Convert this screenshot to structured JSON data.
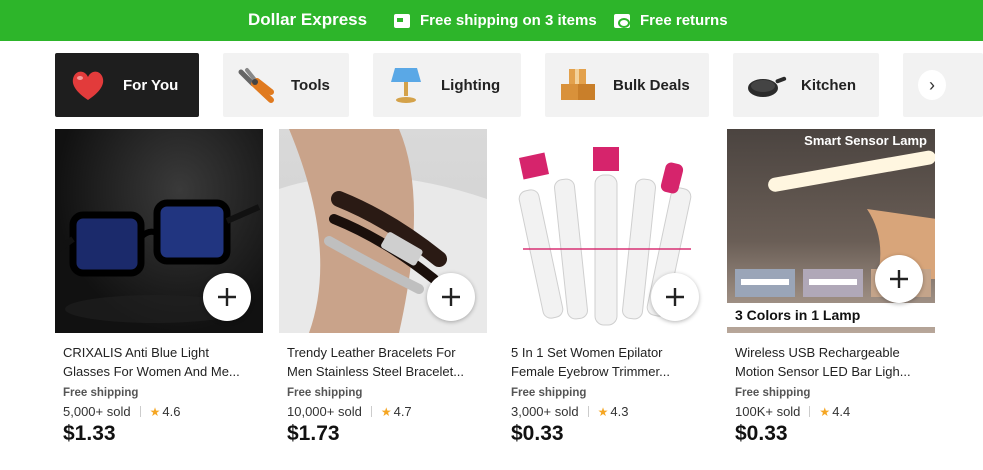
{
  "banner": {
    "brand": "Dollar Express",
    "promo_shipping": "Free shipping on 3 items",
    "promo_returns": "Free returns"
  },
  "categories": [
    {
      "label": "For You",
      "icon": "heart-icon",
      "active": true
    },
    {
      "label": "Tools",
      "icon": "pliers-icon"
    },
    {
      "label": "Lighting",
      "icon": "lamp-icon"
    },
    {
      "label": "Bulk Deals",
      "icon": "boxes-icon"
    },
    {
      "label": "Kitchen",
      "icon": "pan-icon"
    }
  ],
  "scroll_next": "›",
  "products": [
    {
      "title": "CRIXALIS Anti Blue Light Glasses For Women And Me...",
      "shipping": "Free shipping",
      "sold": "5,000+ sold",
      "rating": "4.6",
      "price": "$1.33",
      "image_icon": "glasses-image"
    },
    {
      "title": "Trendy Leather Bracelets For Men Stainless Steel Bracelet...",
      "shipping": "Free shipping",
      "sold": "10,000+ sold",
      "rating": "4.7",
      "price": "$1.73",
      "image_icon": "bracelet-image"
    },
    {
      "title": "5 In 1 Set Women Epilator Female Eyebrow Trimmer...",
      "shipping": "Free shipping",
      "sold": "3,000+ sold",
      "rating": "4.3",
      "price": "$0.33",
      "image_icon": "epilator-image"
    },
    {
      "title": "Wireless USB Rechargeable Motion Sensor LED Bar Ligh...",
      "shipping": "Free shipping",
      "sold": "100K+ sold",
      "rating": "4.4",
      "price": "$0.33",
      "image_icon": "lamp-bar-image",
      "image_text_top": "Smart Sensor Lamp",
      "image_text_bottom": "3 Colors in 1 Lamp"
    }
  ],
  "colors": {
    "banner": "#2db52a",
    "active_tab": "#1e1e1e",
    "star": "#f5a623"
  }
}
